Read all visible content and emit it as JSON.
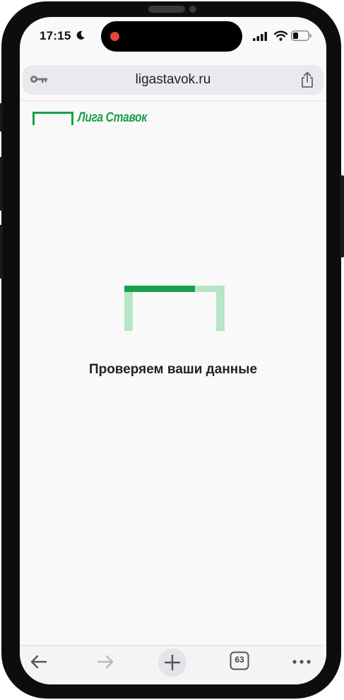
{
  "status_bar": {
    "time": "17:15",
    "moon_icon": "moon-icon",
    "signal_icon": "cellular-signal-icon",
    "wifi_icon": "wifi-icon",
    "battery_icon": "battery-icon",
    "battery_level": 0.35
  },
  "browser": {
    "url": "ligastavok.ru",
    "key_icon": "key-icon",
    "share_icon": "share-icon"
  },
  "site": {
    "logo_text": "Лига Ставок",
    "loading_text": "Проверяем ваши данные",
    "brand_color": "#1aa04a",
    "brand_light_color": "#b6e6c7"
  },
  "toolbar": {
    "back_icon": "arrow-left-icon",
    "forward_icon": "arrow-right-icon",
    "new_tab_icon": "plus-icon",
    "tabs_count": "63",
    "more_icon": "ellipsis-icon"
  }
}
